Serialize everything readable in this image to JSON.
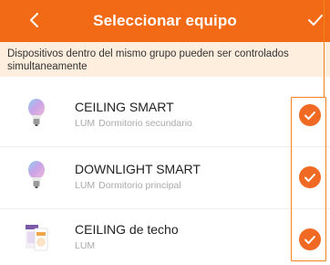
{
  "header": {
    "title": "Seleccionar equipo",
    "color": "#f26a16"
  },
  "banner": {
    "text": "Dispositivos dentro del mismo grupo pueden ser controlados simultaneamente"
  },
  "devices": [
    {
      "name": "CEILING SMART",
      "type": "LUM",
      "room": "Dormitorio secundario",
      "selected": true,
      "icon": "smart-bulb-icon"
    },
    {
      "name": "DOWNLIGHT SMART",
      "type": "LUM",
      "room": "Dormitorio principal",
      "selected": true,
      "icon": "smart-bulb-icon"
    },
    {
      "name": "CEILING de techo",
      "type": "LUM",
      "room": "",
      "selected": true,
      "icon": "ceiling-light-box-icon"
    }
  ],
  "colors": {
    "accent": "#f06a23",
    "banner_bg": "#fdeede"
  }
}
